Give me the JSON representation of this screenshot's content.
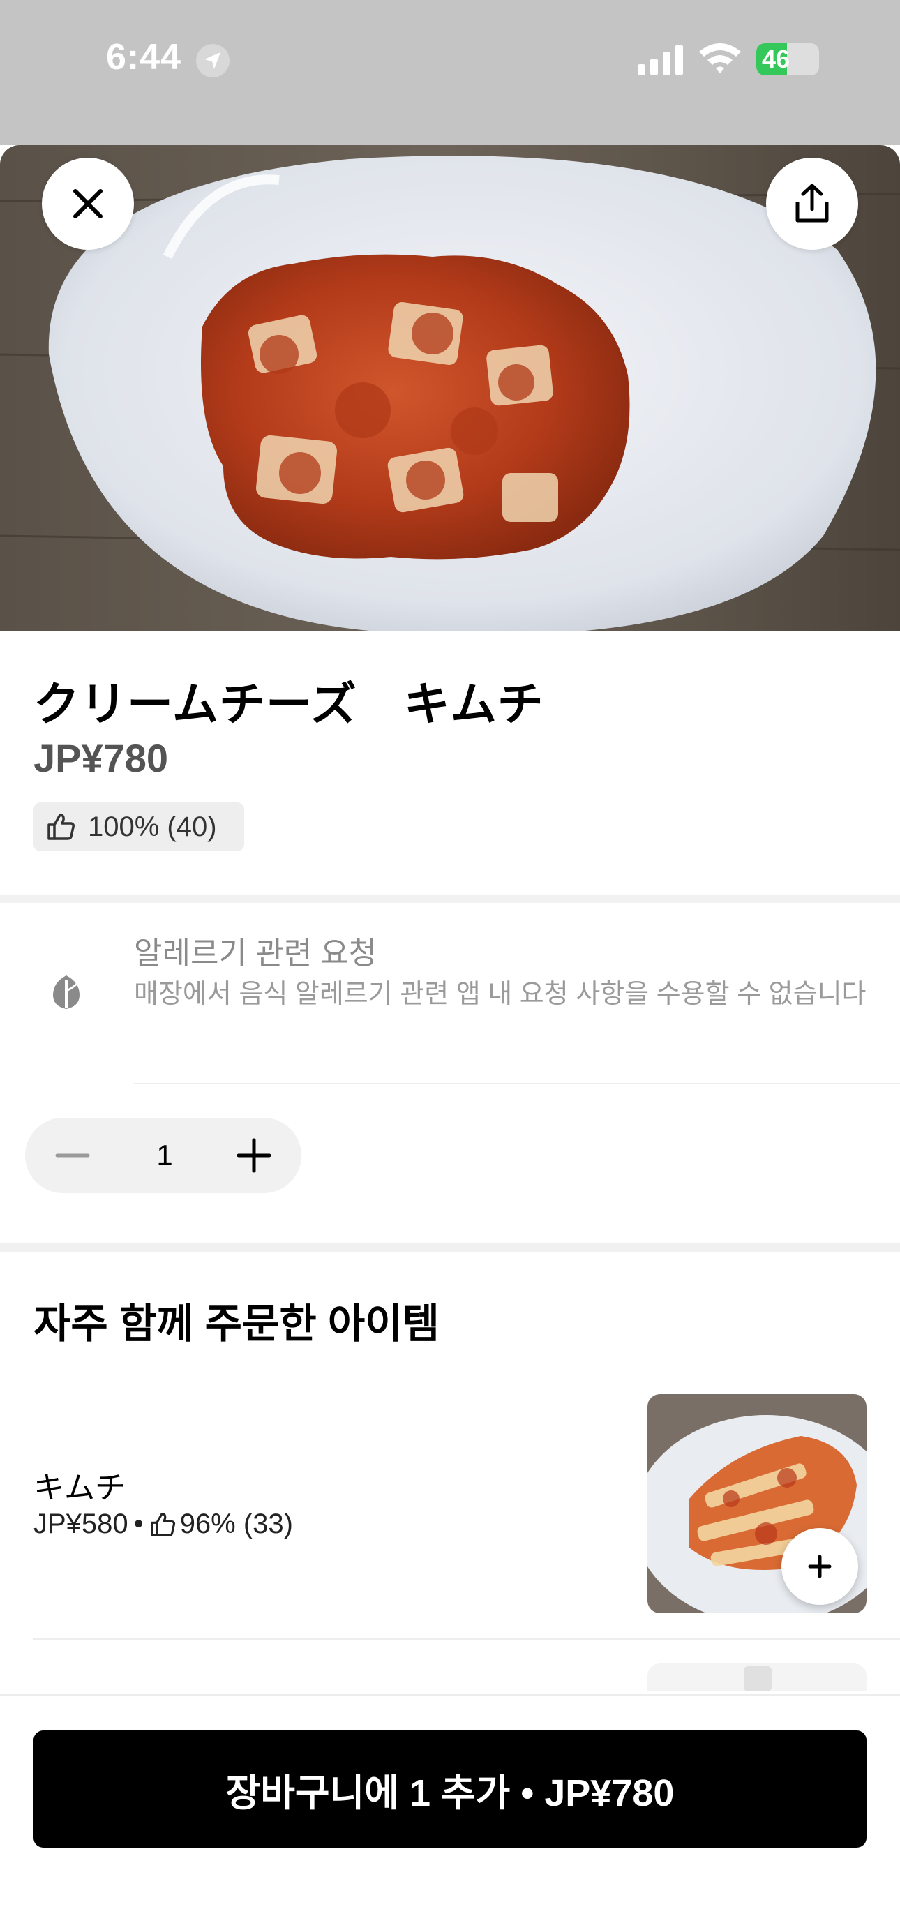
{
  "status_bar": {
    "time": "6:44",
    "battery": "46",
    "icons": [
      "location-arrow-icon",
      "cellular-signal-icon",
      "wifi-icon",
      "battery-icon"
    ]
  },
  "header": {
    "close_icon": "close-icon",
    "share_icon": "share-icon"
  },
  "product": {
    "title": "クリームチーズ　キムチ",
    "price": "JP¥780",
    "rating": "100% (40)",
    "rating_icon": "thumbs-up-icon"
  },
  "allergy": {
    "icon": "leaf-icon",
    "title": "알레르기 관련 요청",
    "description": "매장에서 음식 알레르기 관련 앱 내 요청 사항을 수용할 수 없습니다"
  },
  "quantity": {
    "value": "1",
    "minus_icon": "minus-icon",
    "plus_icon": "plus-icon"
  },
  "frequently_ordered": {
    "title": "자주 함께 주문한 아이템",
    "items": [
      {
        "name": "キムチ",
        "price": "JP¥580",
        "separator": "•",
        "rating": "96% (33)"
      }
    ]
  },
  "cart_button": {
    "label": "장바구니에 1 추가 • JP¥780"
  },
  "colors": {
    "status_bar_bg": "#c4c4c4",
    "cart_button_bg": "#000000",
    "battery_green": "#34c759"
  }
}
